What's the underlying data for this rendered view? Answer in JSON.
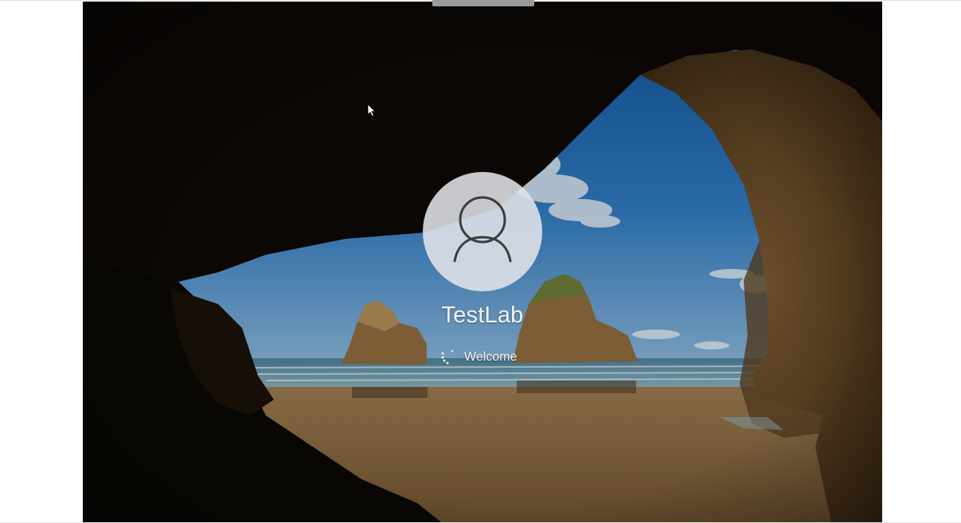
{
  "lock_screen": {
    "user": {
      "name": "TestLab",
      "status": "Welcome",
      "avatar_icon": "user-silhouette-icon"
    },
    "colors": {
      "text": "#f2f2f2",
      "avatar_bg": "#e1e4e8",
      "avatar_glyph": "#3c3c3c"
    }
  }
}
